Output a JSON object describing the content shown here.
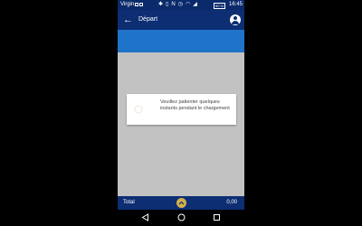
{
  "status_bar": {
    "carrier": "Virgin",
    "battery": "90 %",
    "time": "16:45"
  },
  "app_bar": {
    "title": "Départ"
  },
  "loading_dialog": {
    "message": "Veuillez patienter quelques instants pendant le chargement"
  },
  "footer": {
    "total_label": "Total",
    "total_amount": "0,00"
  },
  "colors": {
    "status_bar": "#0b2a6b",
    "app_bar": "#0d2e73",
    "sub_bar": "#1f74c9",
    "content_background": "#c2c2c2",
    "accent": "#d4b04a"
  },
  "icons": {
    "back": "arrow-left-icon",
    "account": "account-circle-icon",
    "expand": "chevron-up-icon",
    "nav": [
      "back-triangle-icon",
      "home-circle-icon",
      "recents-square-icon"
    ]
  }
}
